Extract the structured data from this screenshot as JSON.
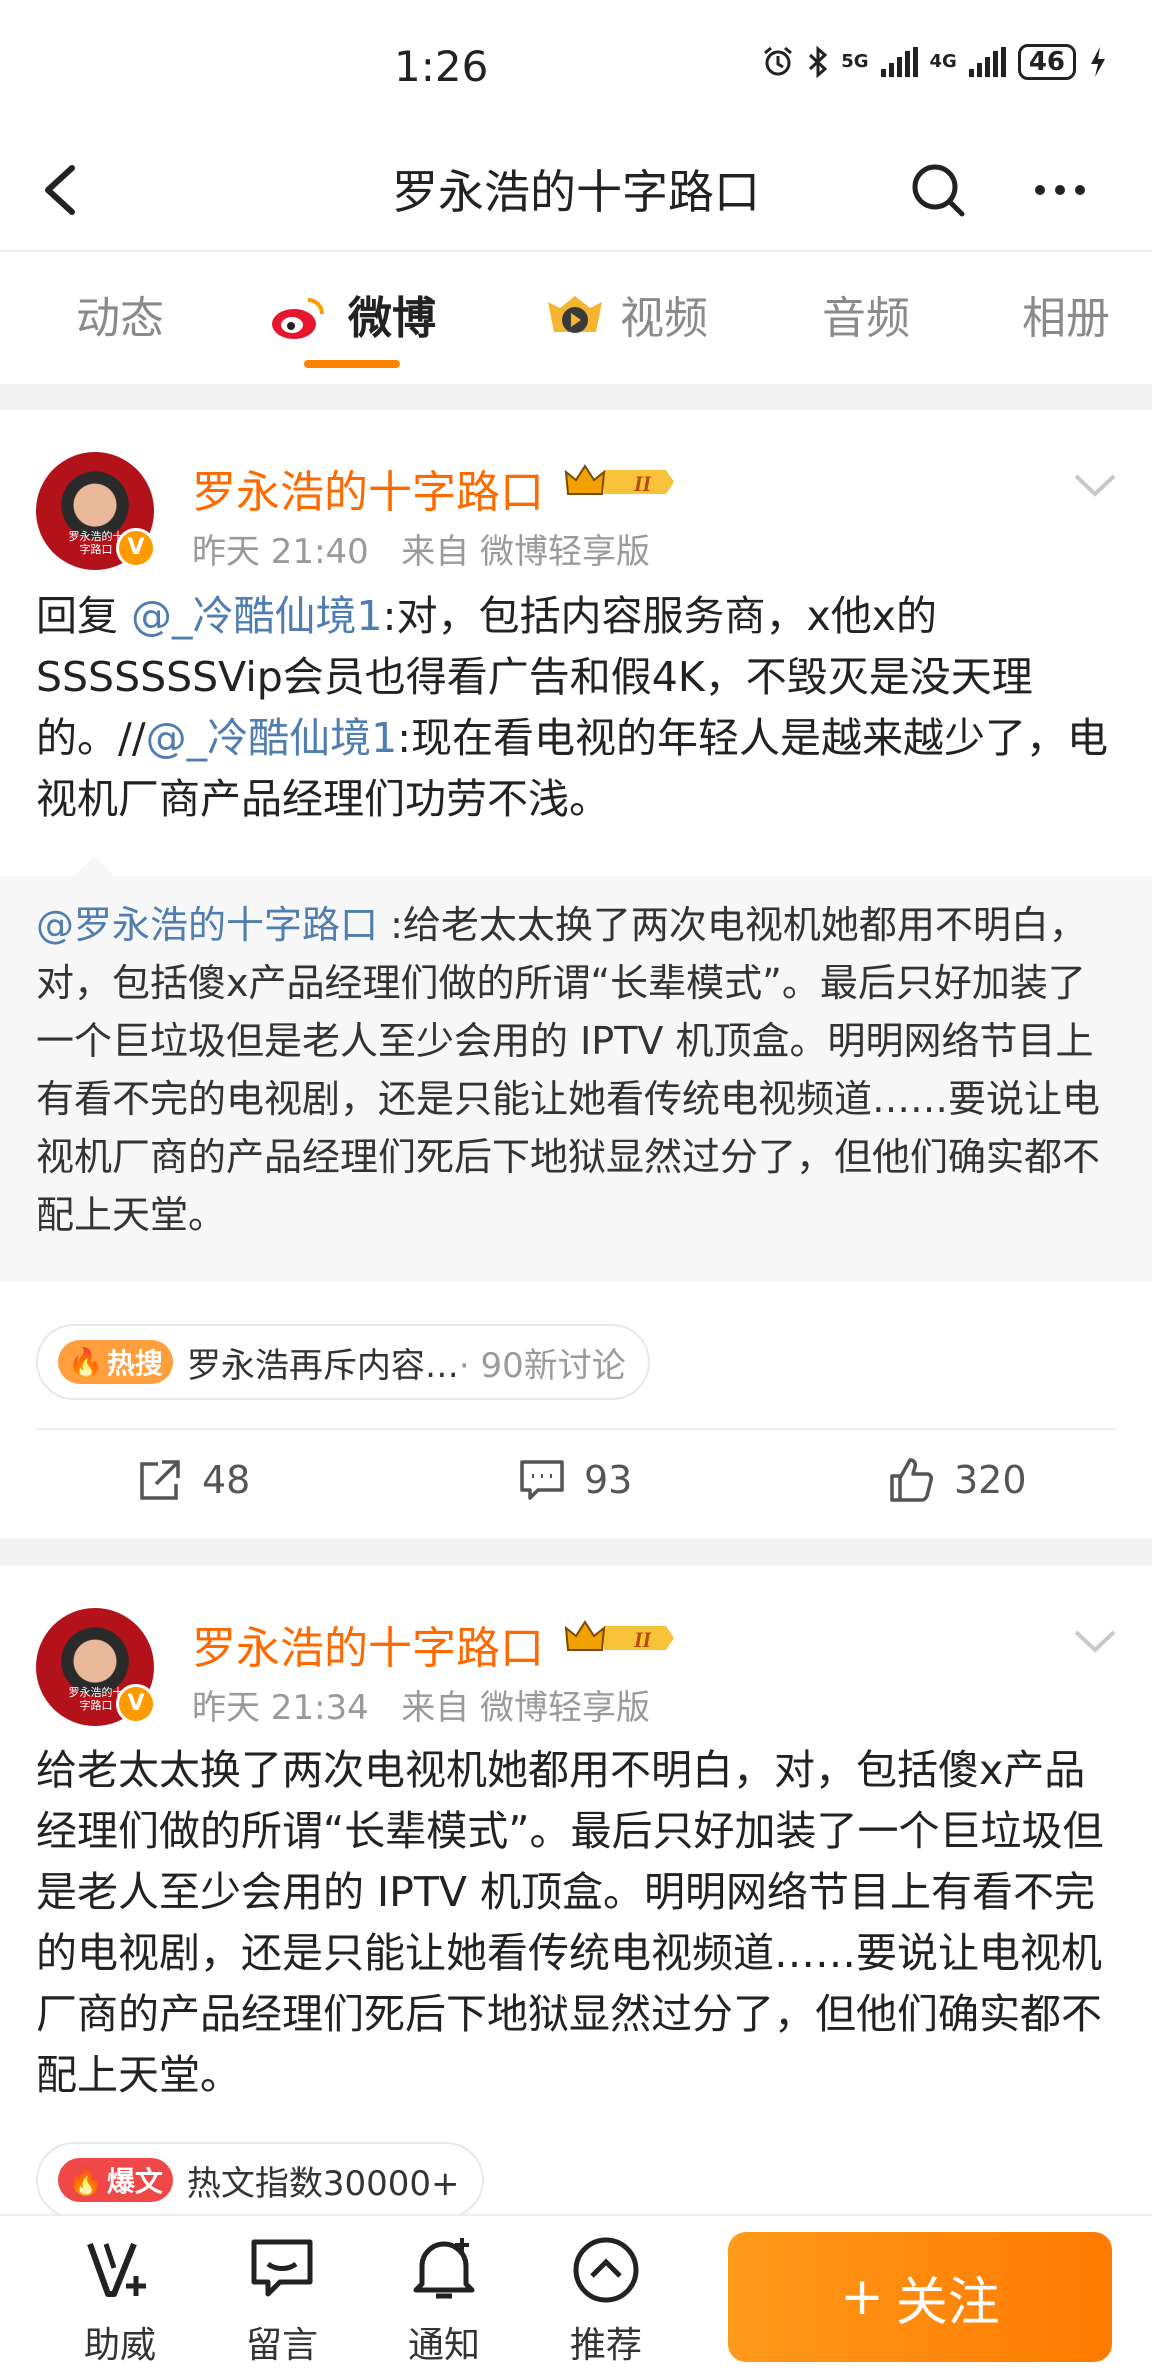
{
  "status_bar": {
    "time": "1:26",
    "battery": "46",
    "net1": "5G",
    "net2": "4G"
  },
  "header": {
    "title": "罗永浩的十字路口"
  },
  "tabs": [
    {
      "label": "动态"
    },
    {
      "label": "微博"
    },
    {
      "label": "视频"
    },
    {
      "label": "音频"
    },
    {
      "label": "相册"
    }
  ],
  "posts": [
    {
      "author": "罗永浩的十字路口",
      "level": "II",
      "time": "昨天 21:40",
      "source": "来自 微博轻享版",
      "reply_prefix": "回复 ",
      "mention1": "@_冷酷仙境1",
      "text1": ":对，包括内容服务商，x他x的SSSSSSSVip会员也得看广告和假4K，不毁灭是没天理的。//",
      "mention2": "@_冷酷仙境1",
      "text2": ":现在看电视的年轻人是越来越少了，电视机厂商产品经理们功劳不浅。",
      "retweet_mention": "@罗永浩的十字路口",
      "retweet_text": " :给老太太换了两次电视机她￼都用不明白，对，包括傻x产品经理们做的所谓“长辈模式”。最后只好加装了一个巨垃圾但是老人至少会用的￼ IPTV 机顶盒。明明网络节目上有看不完的电视剧，还是只能让她看传统电视频道￼……要说让电视机厂商的产品经理们死后下地狱显然过分了，但他们确实都不配上天堂。",
      "topic_badge": "热搜",
      "topic_text": "罗永浩再斥内容…",
      "topic_sub": " · 90新讨论",
      "repost_count": "48",
      "comment_count": "93",
      "like_count": "320"
    },
    {
      "author": "罗永浩的十字路口",
      "level": "II",
      "time": "昨天 21:34",
      "source": "来自 微博轻享版",
      "text": "给老太太换了两次电视机她￼都用不明白，对，包括傻x产品经理们做的所谓“长辈模式”。最后只好加装了一个巨垃圾但是老人至少会用的￼ IPTV 机顶盒。明明网络节目上有看不完的电视剧，还是只能让她看传统电视频道￼……要说让电视机厂商的产品经理们死后下地狱显然过分了，但他们确实都不配上天堂。",
      "topic_badge": "爆文",
      "topic_text": "热文指数30000+"
    }
  ],
  "avatar_caption": "罗永浩的十字路口",
  "bottom_bar": [
    {
      "label": "助威"
    },
    {
      "label": "留言"
    },
    {
      "label": "通知"
    },
    {
      "label": "推荐"
    }
  ],
  "follow_label": "关注",
  "colors": {
    "accent": "#ff8200",
    "author": "#ff6a00",
    "mention": "#507daf"
  }
}
